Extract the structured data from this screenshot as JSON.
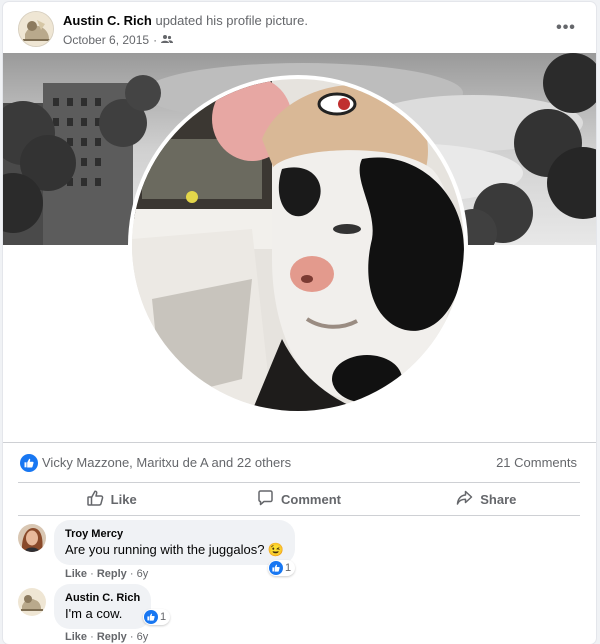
{
  "post": {
    "author": "Austin C. Rich",
    "action": "updated his profile picture.",
    "date": "October 6, 2015",
    "separator": "·",
    "audience_icon": "friends-icon",
    "more_label": "•••"
  },
  "reactions": {
    "icon": "like-icon",
    "summary": "Vicky Mazzone, Maritxu de A and 22 others",
    "comments_count": "21 Comments"
  },
  "actions": {
    "like_label": "Like",
    "comment_label": "Comment",
    "share_label": "Share"
  },
  "comments": [
    {
      "name": "Troy Mercy",
      "text": "Are you running with the juggalos?",
      "emoji": "😉",
      "reaction_count": "1",
      "like_label": "Like",
      "reply_label": "Reply",
      "dot": "·",
      "age": "6y"
    },
    {
      "name": "Austin C. Rich",
      "text": "I'm a cow.",
      "reaction_count": "1",
      "like_label": "Like",
      "reply_label": "Reply",
      "dot": "·",
      "age": "6y"
    }
  ],
  "colors": {
    "accent": "#1877f2",
    "muted_text": "#65676b",
    "bubble": "#f0f2f5"
  }
}
